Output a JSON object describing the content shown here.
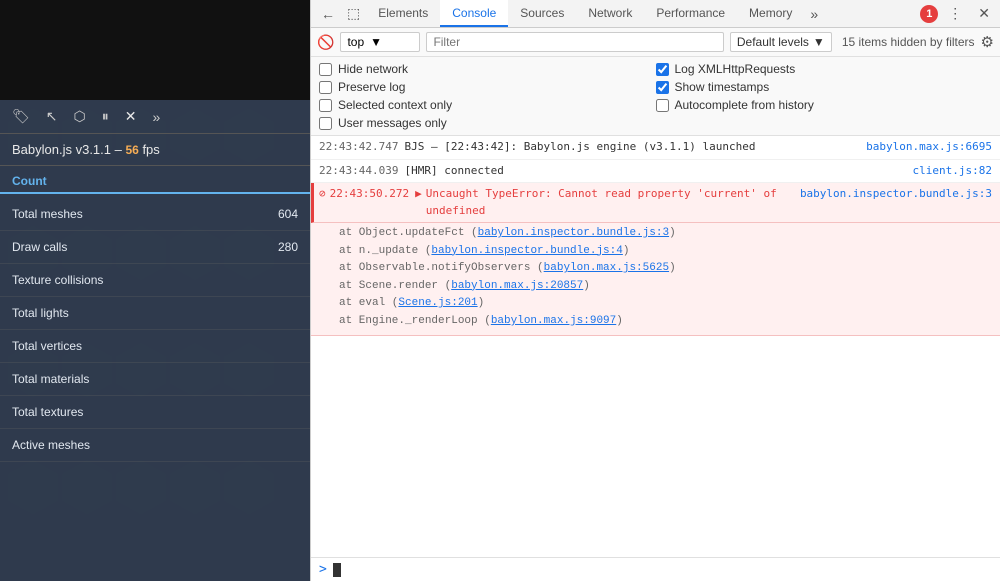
{
  "leftPanel": {
    "fps_label": "Babylon.js v3.1.1 – ",
    "fps_value": "56",
    "fps_suffix": " fps",
    "stats_header": "Count",
    "stats": [
      {
        "label": "Total meshes",
        "value": "604"
      },
      {
        "label": "Draw calls",
        "value": "280"
      },
      {
        "label": "Texture collisions",
        "value": ""
      },
      {
        "label": "Total lights",
        "value": ""
      },
      {
        "label": "Total vertices",
        "value": ""
      },
      {
        "label": "Total materials",
        "value": ""
      },
      {
        "label": "Total textures",
        "value": ""
      },
      {
        "label": "Active meshes",
        "value": ""
      }
    ]
  },
  "devtools": {
    "tabs": [
      {
        "label": "Elements",
        "active": false
      },
      {
        "label": "Console",
        "active": true
      },
      {
        "label": "Sources",
        "active": false
      },
      {
        "label": "Network",
        "active": false
      },
      {
        "label": "Performance",
        "active": false
      },
      {
        "label": "Memory",
        "active": false
      }
    ],
    "error_count": "1",
    "console": {
      "top_value": "top",
      "filter_placeholder": "Filter",
      "levels_label": "Default levels",
      "hidden_label": "15 items hidden by filters",
      "options": {
        "hide_network": "Hide network",
        "preserve_log": "Preserve log",
        "selected_context": "Selected context only",
        "user_messages": "User messages only",
        "log_xml": "Log XMLHttpRequests",
        "show_timestamps": "Show timestamps",
        "autocomplete": "Autocomplete from history"
      },
      "log_entries": [
        {
          "timestamp": "22:43:42.747",
          "message": "BJS – [22:43:42]: Babylon.js engine (v3.1.1) launched",
          "source": "babylon.max.js:6695",
          "type": "info"
        },
        {
          "timestamp": "22:43:44.039",
          "message": "[HMR] connected",
          "source": "client.js:82",
          "type": "info"
        }
      ],
      "error_entry": {
        "timestamp": "22:43:50.272",
        "arrow": "▶",
        "main_message": "Uncaught TypeError: Cannot read property 'current' of undefined",
        "source": "babylon.inspector.bundle.js:3",
        "stack": [
          {
            "text": "at Object.updateFct (",
            "link": "babylon.inspector.bundle.js:3",
            "link_text": "babylon.inspector.bundle.js:3",
            "suffix": ")"
          },
          {
            "text": "at n._update (",
            "link": "babylon.inspector.bundle.js:4",
            "link_text": "babylon.inspector.bundle.js:4",
            "suffix": ")"
          },
          {
            "text": "at Observable.notifyObservers (",
            "link": "babylon.max.js:5625",
            "link_text": "babylon.max.js:5625",
            "suffix": ")"
          },
          {
            "text": "at Scene.render (",
            "link": "babylon.max.js:20857",
            "link_text": "babylon.max.js:20857",
            "suffix": ")"
          },
          {
            "text": "at eval (",
            "link": "Scene.js:201",
            "link_text": "Scene.js:201",
            "suffix": ")"
          },
          {
            "text": "at Engine._renderLoop (",
            "link": "babylon.max.js:9097",
            "link_text": "babylon.max.js:9097",
            "suffix": ")"
          }
        ]
      },
      "prompt_symbol": ">",
      "cursor": "|"
    }
  }
}
